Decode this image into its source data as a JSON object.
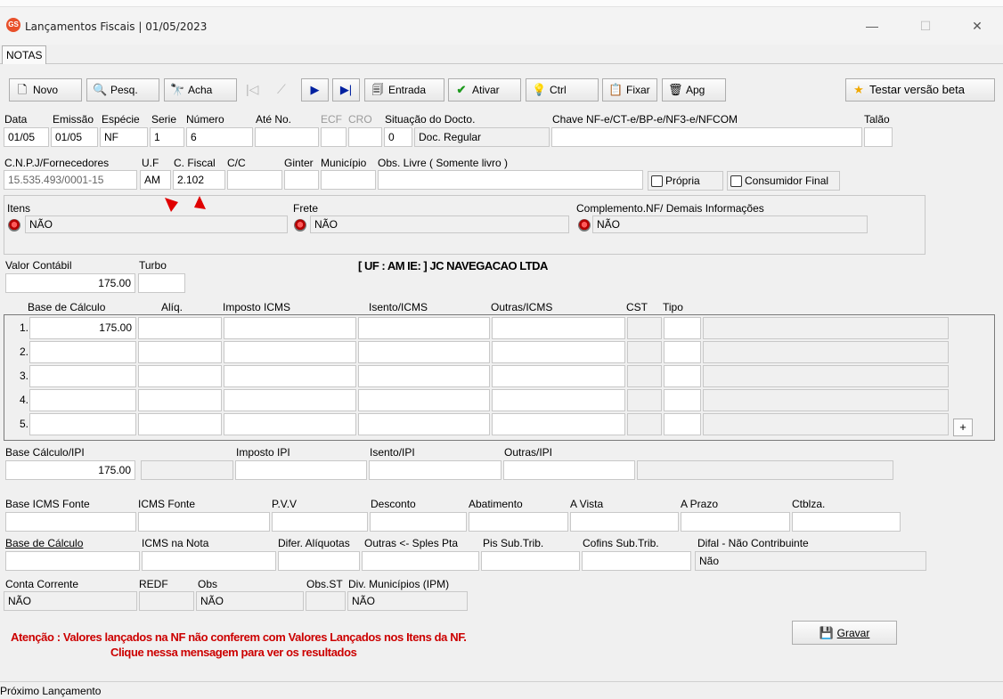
{
  "window": {
    "title": "Lançamentos Fiscais |  01/05/2023",
    "minimize": "—",
    "maximize": "☐",
    "close": "✕",
    "logo_text": "GS"
  },
  "tabs": [
    "NOTAS"
  ],
  "toolbar": {
    "novo": "Novo",
    "pesq": "Pesq.",
    "acha": "Acha",
    "entrada": "Entrada",
    "ativar": "Ativar",
    "ctrl": "Ctrl",
    "fixar": "Fixar",
    "apg": "Apg",
    "testar": "Testar versão beta"
  },
  "doc_header": {
    "labels": {
      "data": "Data",
      "emissao": "Emissão",
      "especie": "Espécie",
      "serie": "Serie",
      "numero": "Número",
      "ate_no": "Até No.",
      "ecf": "ECF",
      "cro": "CRO",
      "situacao": "Situação do Docto.",
      "chave": "Chave NF-e/CT-e/BP-e/NF3-e/NFCOM",
      "talao": "Talão"
    },
    "values": {
      "data": "01/05",
      "emissao": "01/05",
      "especie": "NF",
      "serie": "1",
      "numero": "6",
      "ate_no": "",
      "ecf": "",
      "cro": "",
      "situacao_code": "0",
      "situacao_desc": "Doc. Regular",
      "chave": "",
      "talao": ""
    }
  },
  "supplier": {
    "labels": {
      "cnpj": "C.N.P.J/Fornecedores",
      "uf": "U.F",
      "cfiscal": "C. Fiscal",
      "cc": "C/C",
      "ginter": "Ginter",
      "municipio": "Município",
      "obs_livre": "Obs. Livre ( Somente livro )"
    },
    "values": {
      "cnpj": "15.535.493/0001-15",
      "uf": "AM",
      "cfiscal": "2.102",
      "cc": "",
      "ginter": "",
      "municipio": "",
      "obs_livre": ""
    },
    "propria": "Própria",
    "consumidor_final": "Consumidor Final"
  },
  "flags": {
    "itens_label": "Itens",
    "itens_value": "NÃO",
    "frete_label": "Frete",
    "frete_value": "NÃO",
    "complemento_label": "Complemento.NF/ Demais Informações",
    "complemento_value": "NÃO"
  },
  "valor": {
    "contabil_label": "Valor Contábil",
    "contabil_value": "175.00",
    "turbo_label": "Turbo",
    "turbo_value": "",
    "uf_info": "[ UF : AM IE:  ] JC NAVEGACAO LTDA"
  },
  "icms_grid": {
    "headers": [
      "Base de Cálculo",
      "Alíq.",
      "Imposto ICMS",
      "Isento/ICMS",
      "Outras/ICMS",
      "CST",
      "Tipo"
    ],
    "rows": [
      {
        "n": "1.",
        "base": "175.00"
      },
      {
        "n": "2.",
        "base": ""
      },
      {
        "n": "3.",
        "base": ""
      },
      {
        "n": "4.",
        "base": ""
      },
      {
        "n": "5.",
        "base": ""
      }
    ],
    "add": "+"
  },
  "ipi": {
    "base_label": "Base Cálculo/IPI",
    "base_value": "175.00",
    "imposto_label": "Imposto IPI",
    "isento_label": "Isento/IPI",
    "outras_label": "Outras/IPI"
  },
  "fonte": {
    "base_icms_fonte": "Base ICMS Fonte",
    "icms_fonte": "ICMS Fonte",
    "pvv": "P.V.V",
    "desconto": "Desconto",
    "abatimento": "Abatimento",
    "a_vista": "A Vista",
    "a_prazo": "A Prazo",
    "ctblza": "Ctblza."
  },
  "subtrib": {
    "base_calculo": "Base de Cálculo",
    "icms_nota": "ICMS na Nota",
    "difer": "Difer. Alíquotas",
    "outras_spl": "Outras <- Sples Pta",
    "pis_sub": "Pis Sub.Trib.",
    "cofins_sub": "Cofins Sub.Trib.",
    "difal_label": "Difal - Não Contribuinte",
    "difal_value": "Não"
  },
  "bottom": {
    "conta_corrente_label": "Conta Corrente",
    "conta_corrente_value": "NÃO",
    "redf_label": "REDF",
    "obs_label": "Obs",
    "obs_value": "NÃO",
    "obs_st_label": "Obs.ST",
    "div_mun_label": "Div. Municípios (IPM)",
    "div_mun_value": "NÃO"
  },
  "warning": {
    "line1": "Atenção : Valores lançados na NF não conferem com Valores Lançados nos Itens da NF.",
    "line2": "Clique nessa mensagem para ver os resultados"
  },
  "gravar": "Gravar",
  "status": "Próximo  Lançamento",
  "colors": {
    "warning": "#cc0000",
    "arrow": "#e00000",
    "window_bg": "#f0f0f0"
  }
}
